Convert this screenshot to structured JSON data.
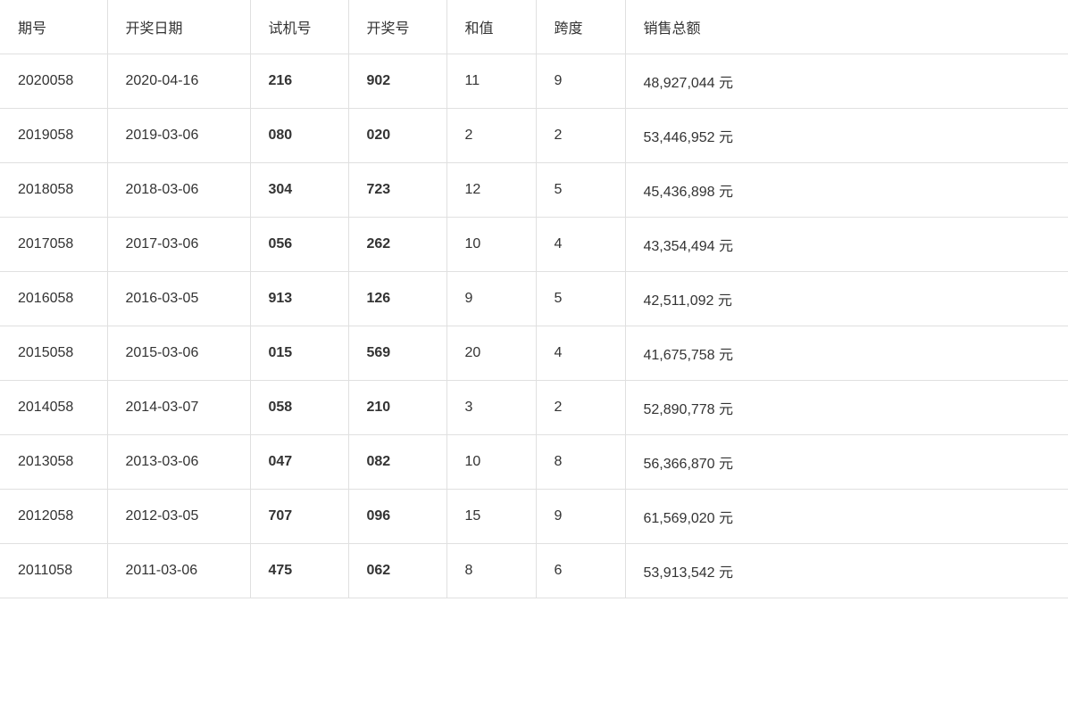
{
  "table": {
    "headers": [
      "期号",
      "开奖日期",
      "试机号",
      "开奖号",
      "和值",
      "跨度",
      "销售总额"
    ],
    "rows": [
      {
        "qihao": "2020058",
        "date": "2020-04-16",
        "shiji": "216",
        "kaij": "902",
        "hezhi": "11",
        "kuadu": "9",
        "sales": "48,927,044 元"
      },
      {
        "qihao": "2019058",
        "date": "2019-03-06",
        "shiji": "080",
        "kaij": "020",
        "hezhi": "2",
        "kuadu": "2",
        "sales": "53,446,952 元"
      },
      {
        "qihao": "2018058",
        "date": "2018-03-06",
        "shiji": "304",
        "kaij": "723",
        "hezhi": "12",
        "kuadu": "5",
        "sales": "45,436,898 元"
      },
      {
        "qihao": "2017058",
        "date": "2017-03-06",
        "shiji": "056",
        "kaij": "262",
        "hezhi": "10",
        "kuadu": "4",
        "sales": "43,354,494 元"
      },
      {
        "qihao": "2016058",
        "date": "2016-03-05",
        "shiji": "913",
        "kaij": "126",
        "hezhi": "9",
        "kuadu": "5",
        "sales": "42,511,092 元"
      },
      {
        "qihao": "2015058",
        "date": "2015-03-06",
        "shiji": "015",
        "kaij": "569",
        "hezhi": "20",
        "kuadu": "4",
        "sales": "41,675,758 元"
      },
      {
        "qihao": "2014058",
        "date": "2014-03-07",
        "shiji": "058",
        "kaij": "210",
        "hezhi": "3",
        "kuadu": "2",
        "sales": "52,890,778 元"
      },
      {
        "qihao": "2013058",
        "date": "2013-03-06",
        "shiji": "047",
        "kaij": "082",
        "hezhi": "10",
        "kuadu": "8",
        "sales": "56,366,870 元"
      },
      {
        "qihao": "2012058",
        "date": "2012-03-05",
        "shiji": "707",
        "kaij": "096",
        "hezhi": "15",
        "kuadu": "9",
        "sales": "61,569,020 元"
      },
      {
        "qihao": "2011058",
        "date": "2011-03-06",
        "shiji": "475",
        "kaij": "062",
        "hezhi": "8",
        "kuadu": "6",
        "sales": "53,913,542 元"
      }
    ]
  }
}
